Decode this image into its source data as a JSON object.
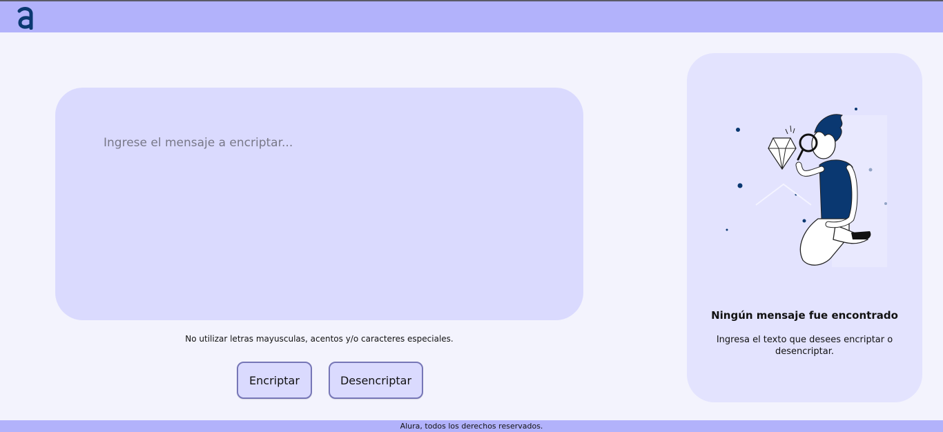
{
  "header": {
    "logo_icon": "alura-logo-icon",
    "brand_color": "#0a3871"
  },
  "input": {
    "placeholder": "Ingrese el mensaje a encriptar...",
    "value": ""
  },
  "hint": "No utilizar letras mayusculas, acentos y/o caracteres especiales.",
  "buttons": {
    "encrypt_label": "Encriptar",
    "decrypt_label": "Desencriptar"
  },
  "output": {
    "illustration_icon": "person-with-magnifying-glass-illustration",
    "title": "Ningún mensaje fue encontrado",
    "text": "Ingresa el texto que desees encriptar o desencriptar."
  },
  "footer": {
    "text": "Alura, todos los derechos reservados."
  },
  "colors": {
    "header_bg": "#b2b2fb",
    "page_bg": "#f3f3fd",
    "input_card_bg": "#dadafe",
    "output_card_bg": "#e3e3fe",
    "button_border": "#7676b6"
  }
}
